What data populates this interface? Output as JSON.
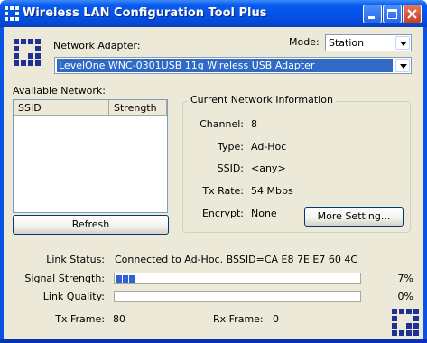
{
  "window": {
    "title": "Wireless LAN Configuration Tool Plus"
  },
  "adapter": {
    "label": "Network Adapter:",
    "value": "LevelOne WNC-0301USB 11g Wireless USB Adapter"
  },
  "mode": {
    "label": "Mode:",
    "value": "Station"
  },
  "available": {
    "label": "Available Network:",
    "columns": [
      "SSID",
      "Strength"
    ],
    "rows": [],
    "refresh_label": "Refresh"
  },
  "current": {
    "title": "Current Network Information",
    "fields": [
      {
        "label": "Channel:",
        "value": "8"
      },
      {
        "label": "Type:",
        "value": "Ad-Hoc"
      },
      {
        "label": "SSID:",
        "value": "<any>"
      },
      {
        "label": "Tx Rate:",
        "value": "54 Mbps"
      },
      {
        "label": "Encrypt:",
        "value": "None"
      }
    ],
    "more_label": "More Setting..."
  },
  "status": {
    "link_status_label": "Link Status:",
    "link_status_value": "Connected to Ad-Hoc. BSSID=CA E8 7E E7 60 4C",
    "signal_label": "Signal Strength:",
    "signal_percent": "7%",
    "signal_level": 0.07,
    "quality_label": "Link Quality:",
    "quality_percent": "0%",
    "quality_level": 0.0,
    "tx_label": "Tx Frame:",
    "tx_value": "80",
    "rx_label": "Rx Frame:",
    "rx_value": "0"
  },
  "icons": {
    "app": "levelone-logo-icon",
    "minimize": "minimize-icon",
    "maximize": "maximize-icon",
    "close": "close-icon"
  },
  "colors": {
    "titlebar": "#0552e8",
    "client_bg": "#ece9d8",
    "selection": "#316ac5",
    "logo": "#1e2f96",
    "progress": "#2f62d6"
  }
}
